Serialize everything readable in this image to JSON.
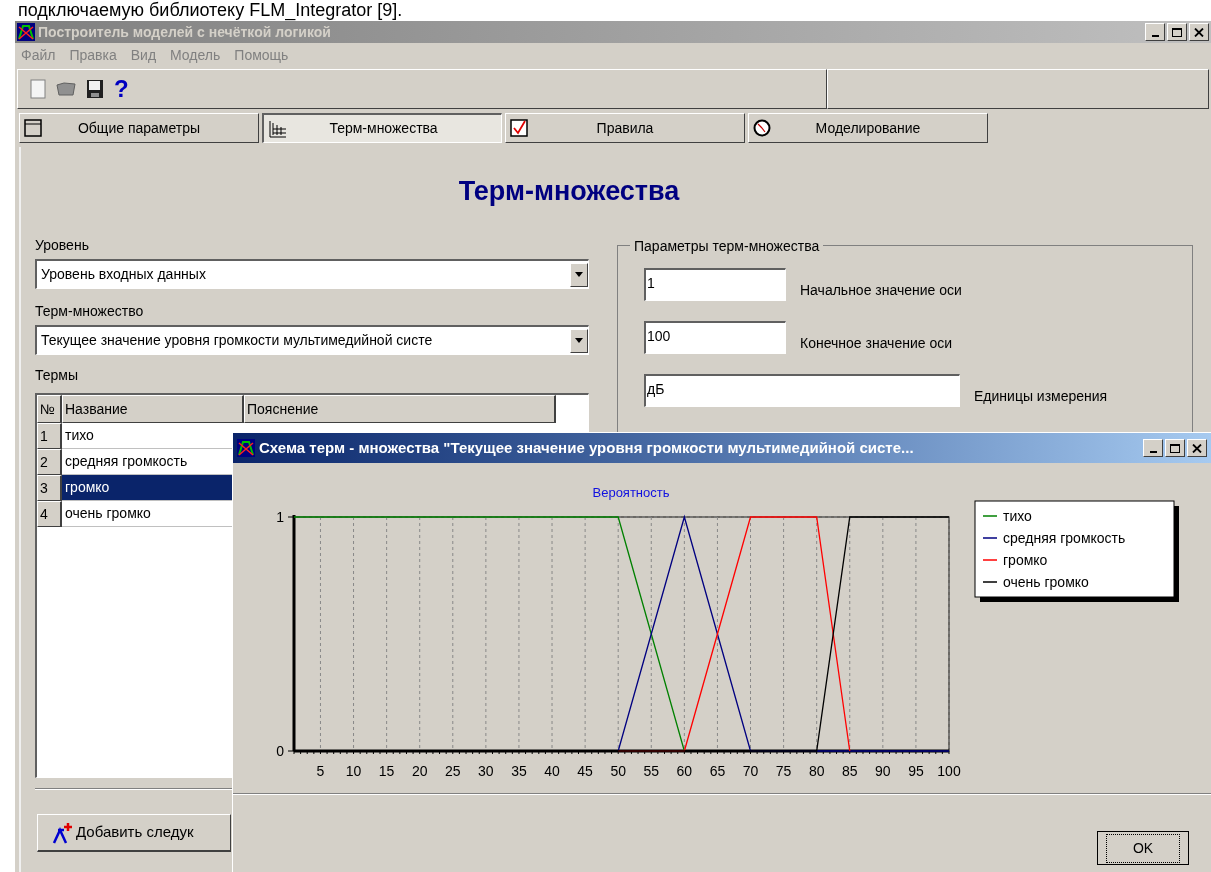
{
  "document_text": "подключаемую библиотеку FLM_Integrator [9].",
  "main_window": {
    "title": "Построитель моделей с нечёткой логикой",
    "menu": [
      "Файл",
      "Правка",
      "Вид",
      "Модель",
      "Помощь"
    ],
    "toolbar": {
      "help_label": "?"
    },
    "tabs": [
      {
        "label": "Общие параметры",
        "selected": false
      },
      {
        "label": "Терм-множества",
        "selected": true
      },
      {
        "label": "Правила",
        "selected": false
      },
      {
        "label": "Моделирование",
        "selected": false
      }
    ],
    "heading": "Терм-множества",
    "level": {
      "label": "Уровень",
      "value": "Уровень входных данных"
    },
    "term_set": {
      "label": "Терм-множество",
      "value": "Текущее значение уровня громкости мультимедийной систе"
    },
    "terms": {
      "label": "Термы",
      "columns": [
        "№",
        "Название",
        "Пояснение"
      ],
      "rows": [
        {
          "cells": [
            "1",
            "тихо"
          ],
          "selected": false
        },
        {
          "cells": [
            "2",
            "средняя громкость"
          ],
          "selected": false
        },
        {
          "cells": [
            "3",
            "громко"
          ],
          "selected": true
        },
        {
          "cells": [
            "4",
            "очень громко"
          ],
          "selected": false
        }
      ]
    },
    "add_button": "Добавить следук",
    "params": {
      "title": "Параметры терм-множества",
      "fields": [
        {
          "value": "1",
          "label": "Начальное значение оси"
        },
        {
          "value": "100",
          "label": "Конечное значение оси"
        },
        {
          "value": "дБ",
          "label": "Единицы измерения"
        }
      ]
    }
  },
  "dialog": {
    "title": "Схема терм - множества \"Текущее значение уровня громкости мультимедийной систе...",
    "chart_data": {
      "type": "line",
      "title": "Вероятность",
      "x": [
        1,
        50,
        60,
        70,
        80,
        85,
        100
      ],
      "series": [
        {
          "name": "тихо",
          "color": "#008000",
          "values": [
            1,
            1,
            0,
            null,
            null,
            null,
            null
          ]
        },
        {
          "name": "средняя громкость",
          "color": "#000080",
          "values": [
            null,
            0,
            1,
            0,
            0,
            0,
            0
          ]
        },
        {
          "name": "громко",
          "color": "#ff0000",
          "values": [
            null,
            0,
            0,
            1,
            1,
            0,
            null
          ]
        },
        {
          "name": "очень громко",
          "color": "#000000",
          "values": [
            0,
            0,
            0,
            0,
            0,
            1,
            1
          ]
        }
      ],
      "xlim": [
        1,
        100
      ],
      "ylim": [
        0,
        1
      ],
      "xticks": [
        5,
        10,
        15,
        20,
        25,
        30,
        35,
        40,
        45,
        50,
        55,
        60,
        65,
        70,
        75,
        80,
        85,
        90,
        95,
        100
      ],
      "yticks": [
        0,
        1
      ],
      "grid": true,
      "legend": "right"
    },
    "ok_button": "OK"
  }
}
